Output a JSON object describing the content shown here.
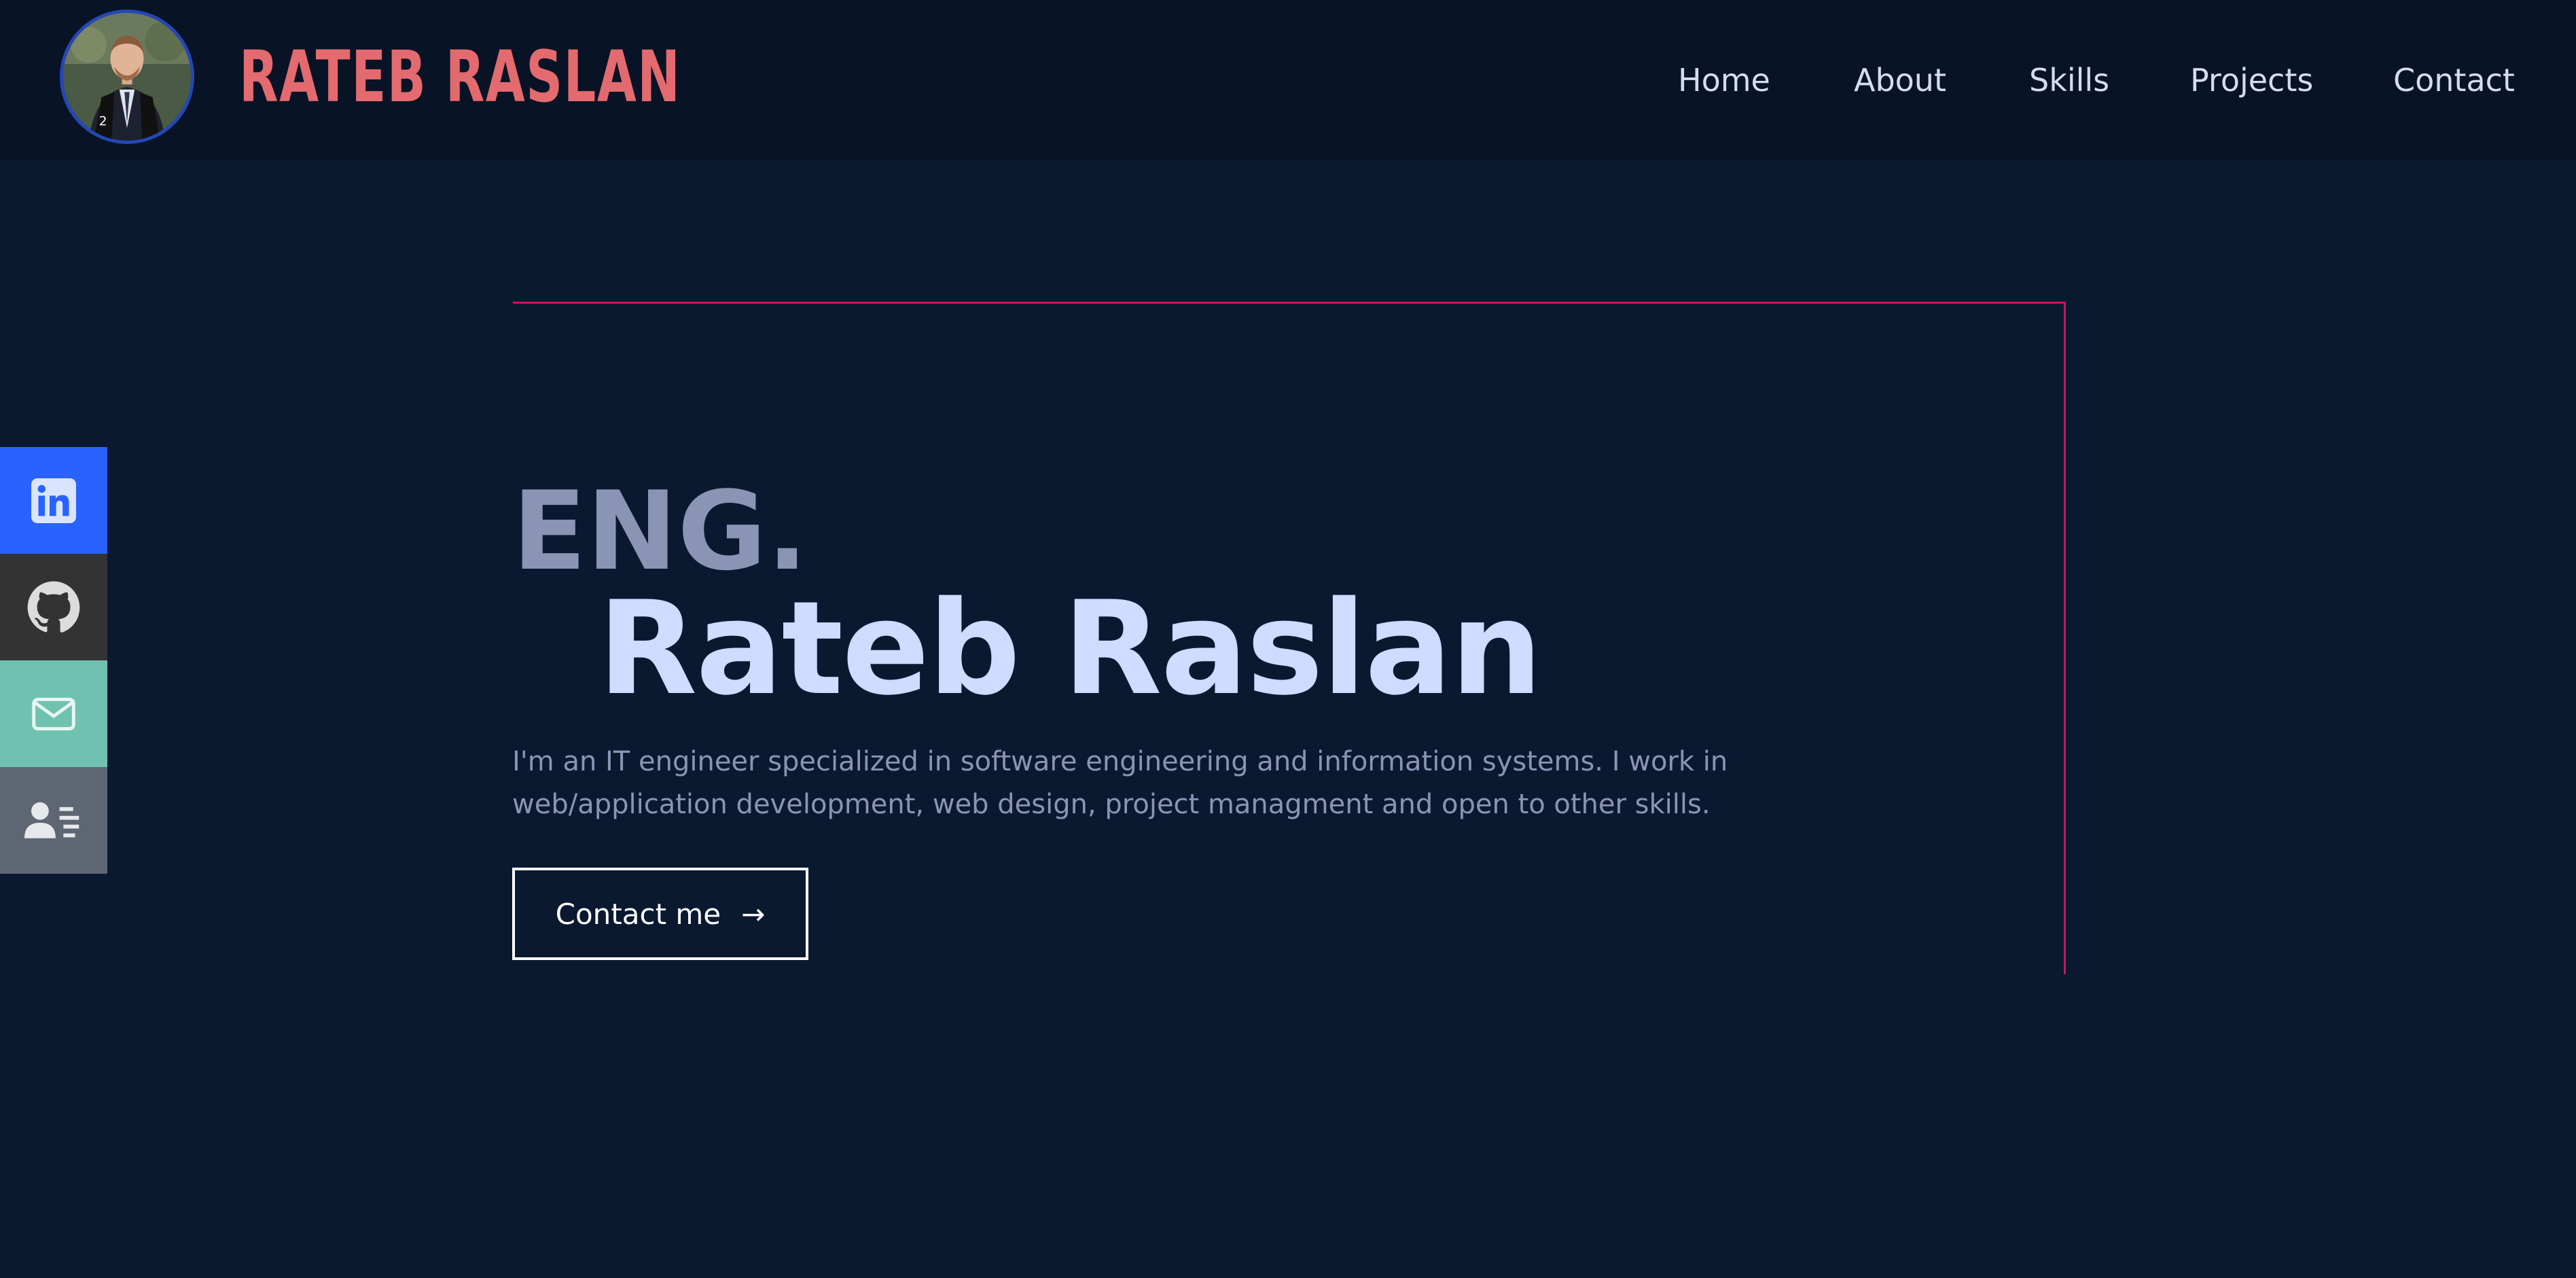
{
  "header": {
    "brand": "RATEB RASLAN",
    "nav": [
      "Home",
      "About",
      "Skills",
      "Projects",
      "Contact"
    ]
  },
  "hero": {
    "prefix": "ENG.",
    "name": "Rateb Raslan",
    "bio": "I'm an IT engineer specialized in software engineering and information systems. I work in web/application development, web design, project managment and open to other skills.",
    "cta_label": "Contact me",
    "cta_arrow": "→"
  },
  "social": [
    {
      "icon": "linkedin-icon",
      "color": "#2962ff"
    },
    {
      "icon": "github-icon",
      "color": "#333333"
    },
    {
      "icon": "mail-icon",
      "color": "#6fc2b0"
    },
    {
      "icon": "resume-icon",
      "color": "#5f6673"
    }
  ],
  "colors": {
    "background": "#0b1930",
    "header": "#091326",
    "brand": "#e36a6e",
    "accent_line": "#c2185b",
    "name": "#cfdbff",
    "muted": "#8a95b5"
  }
}
